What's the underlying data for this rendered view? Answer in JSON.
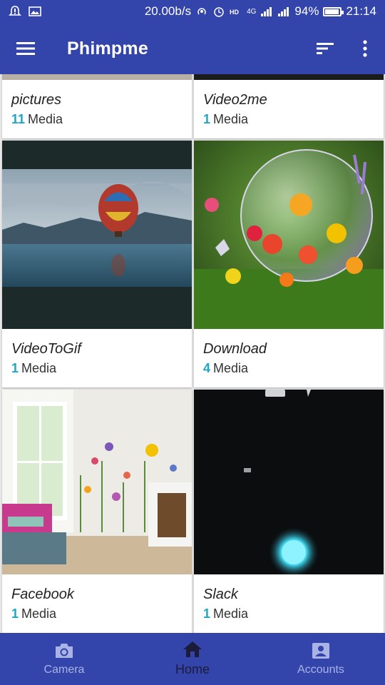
{
  "status_bar": {
    "speed": "20.00b/s",
    "network": "4G",
    "battery": "94%",
    "battery_level": 0.94,
    "time": "21:14"
  },
  "app_bar": {
    "title": "Phimpme",
    "icons": [
      "menu-icon",
      "sort-icon",
      "more-vert-icon"
    ]
  },
  "albums": [
    {
      "name": "pictures",
      "count": "11",
      "unit": "Media"
    },
    {
      "name": "Video2me",
      "count": "1",
      "unit": "Media"
    },
    {
      "name": "VideoToGif",
      "count": "1",
      "unit": "Media"
    },
    {
      "name": "Download",
      "count": "4",
      "unit": "Media"
    },
    {
      "name": "Facebook",
      "count": "1",
      "unit": "Media"
    },
    {
      "name": "Slack",
      "count": "1",
      "unit": "Media"
    }
  ],
  "bottom_nav": {
    "items": [
      {
        "label": "Camera",
        "icon": "camera-icon"
      },
      {
        "label": "Home",
        "icon": "home-icon"
      },
      {
        "label": "Accounts",
        "icon": "account-box-icon"
      }
    ],
    "active": "Home"
  },
  "colors": {
    "primary": "#3344aa",
    "accent": "#1ea6c8",
    "nav_inactive": "#aab3e6",
    "nav_active": "#1c1c3a"
  }
}
